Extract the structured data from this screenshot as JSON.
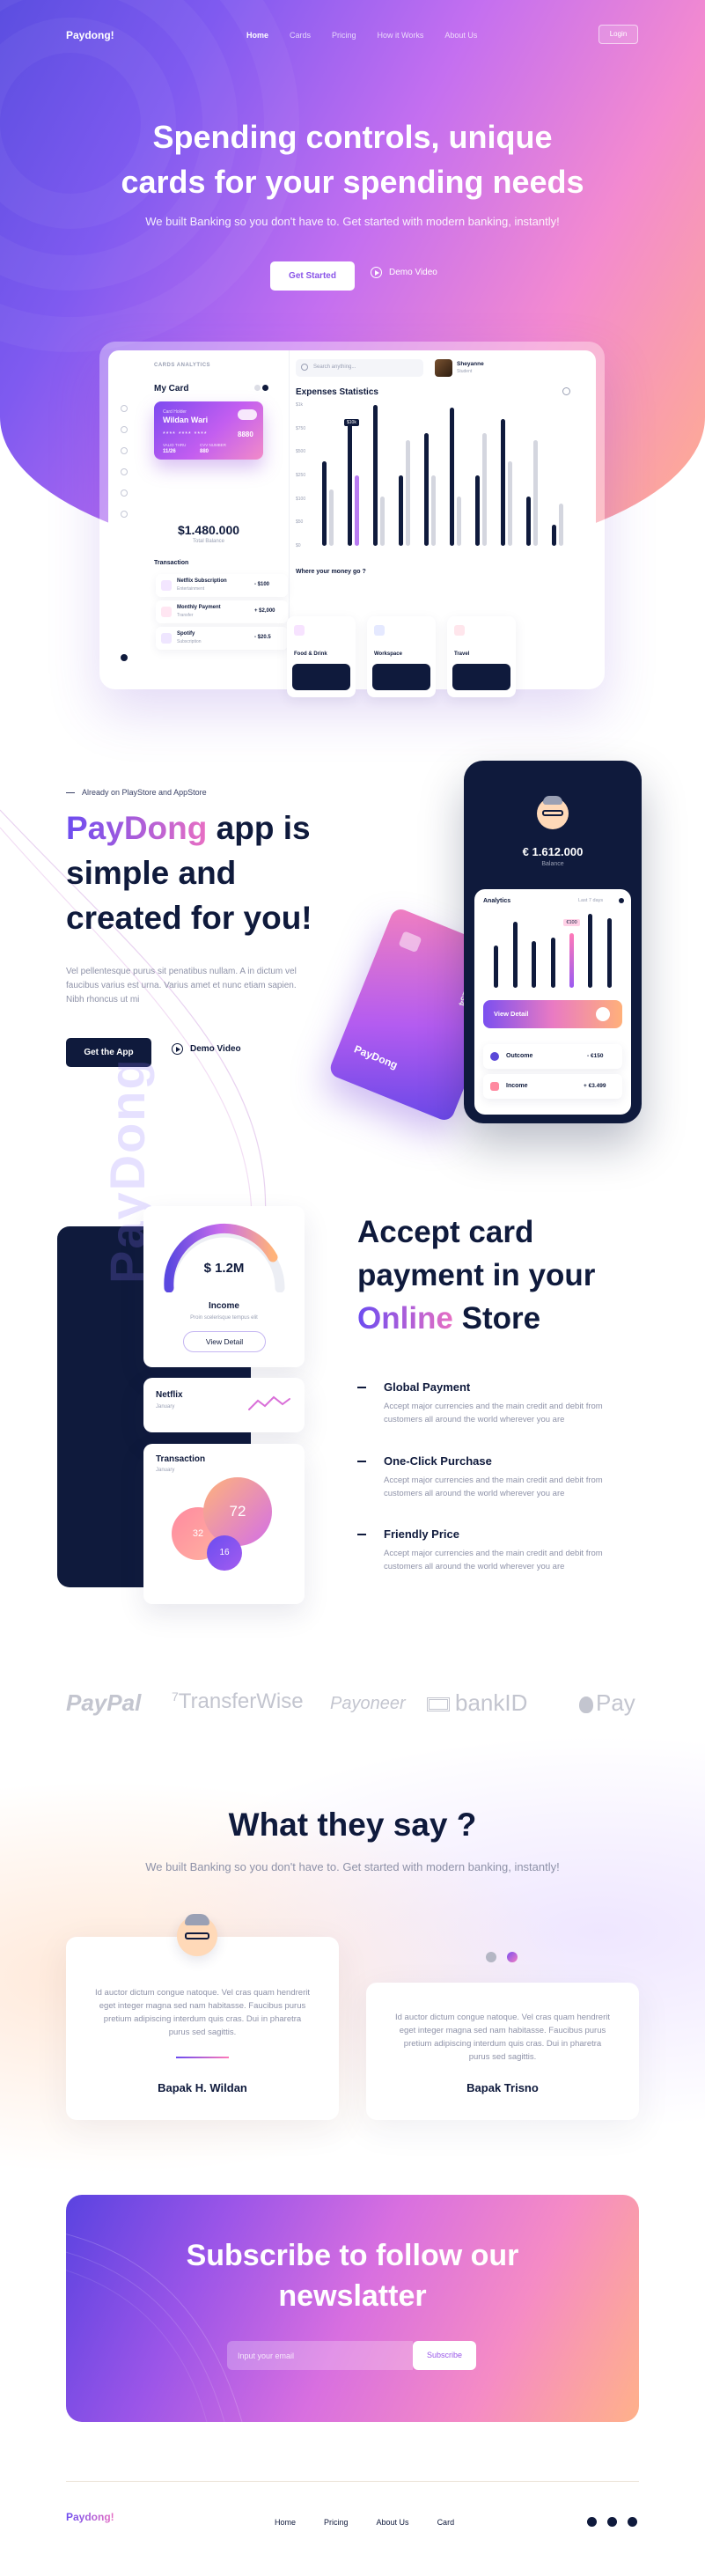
{
  "nav": {
    "logo": "Paydong!",
    "links": [
      "Home",
      "Cards",
      "Pricing",
      "How it Works",
      "About Us"
    ],
    "login": "Login"
  },
  "hero": {
    "title_line1": "Spending controls, unique",
    "title_line2": "cards for your spending needs",
    "subtitle": "We built Banking so you don't have to. Get started with modern banking, instantly!",
    "cta_primary": "Get Started",
    "cta_secondary": "Demo Video"
  },
  "dashboard": {
    "header": "CARDS ANALYTICS",
    "search_placeholder": "Search anything...",
    "user_name": "Sheyanne",
    "user_role": "Student",
    "my_card": "My Card",
    "card_owner_label": "Card Holder",
    "card_owner": "Wildan Wari",
    "card_number_masked": "****  ****  ****",
    "card_number_last": "8880",
    "card_valid_label": "VALID THRU",
    "card_valid": "11/26",
    "card_cvv_label": "CVV NUMBER",
    "card_cvv": "880",
    "balance": "$1.480.000",
    "balance_label": "Total Balance",
    "transaction_title": "Transaction",
    "transactions": [
      {
        "name": "Netflix Subscription",
        "sub": "Entertainment",
        "amount": "- $100"
      },
      {
        "name": "Monthly Payment",
        "sub": "Transfer",
        "amount": "+ $2,000"
      },
      {
        "name": "Spotify",
        "sub": "Subscription",
        "amount": "- $20.5"
      }
    ],
    "expenses_title": "Expenses Statistics",
    "expenses_y": [
      "$1k",
      "$750",
      "$500",
      "$250",
      "$100",
      "$50",
      "$0"
    ],
    "expenses_tag": "$10k",
    "where_title": "Where your money go ?",
    "categories": [
      "Food & Drink",
      "Workspace",
      "Travel"
    ]
  },
  "chart_data": [
    {
      "type": "bar",
      "title": "Expenses Statistics",
      "categories": [
        "1",
        "2",
        "3",
        "4",
        "5",
        "6",
        "7",
        "8",
        "9",
        "10"
      ],
      "series": [
        {
          "values": [
            600,
            900,
            1000,
            500,
            800,
            980,
            500,
            900,
            350,
            150
          ]
        },
        {
          "values": [
            400,
            500,
            350,
            750,
            500,
            350,
            800,
            600,
            750,
            300
          ]
        }
      ],
      "ylim": [
        0,
        1000
      ],
      "colors": {
        "primary": "#0f1a3c",
        "secondary": "#d4d6df",
        "highlight": "#b97cf2"
      }
    },
    {
      "type": "bar",
      "title": "Analytics",
      "categories": [
        "1",
        "2",
        "3",
        "4",
        "5",
        "6",
        "7"
      ],
      "values": [
        55,
        85,
        60,
        65,
        70,
        95,
        90
      ],
      "ylim": [
        0,
        100
      ]
    }
  ],
  "paydong": {
    "eyebrow": "Already on PlayStore and AppStore",
    "title_brand": "PayDong",
    "title_rest1": " app is",
    "title_rest2": "simple and",
    "title_rest3": "created for you!",
    "description": "Vel pellentesque purus sit penatibus nullam. A in dictum vel faucibus varius est urna. Varius amet et nunc etiam sapien. Nibh rhoncus ut mi",
    "cta_primary": "Get the App",
    "cta_secondary": "Demo Video",
    "phone": {
      "balance": "€ 1.612.000",
      "balance_label": "Balance",
      "analytics_label": "Analytics",
      "period": "Last 7 days",
      "tooltip": "€100",
      "view_detail": "View Detail",
      "outcome_label": "Outcome",
      "outcome_value": "- €150",
      "income_label": "Income",
      "income_value": "+ €3.499"
    },
    "card_brand": "PayDong",
    "card_number": "1234"
  },
  "accept": {
    "title_line1": "Accept card",
    "title_line2": "payment in your",
    "title_online": "Online",
    "title_store": " Store",
    "vertical_brand": "PayDong",
    "gauge_value": "$ 1.2M",
    "gauge_label": "Income",
    "gauge_desc": "Proin scelerisque tempus elit",
    "gauge_button": "View Detail",
    "netflix_label": "Netflix",
    "netflix_sub": "January",
    "transaction_label": "Transaction",
    "transaction_sub": "January",
    "bubbles": [
      "72",
      "32",
      "16"
    ],
    "features": [
      {
        "title": "Global Payment",
        "text": "Accept major currencies and the main credit and debit from customers all around the world wherever you are"
      },
      {
        "title": "One-Click Purchase",
        "text": "Accept major currencies and the main credit and debit from customers all around the world wherever you are"
      },
      {
        "title": "Friendly Price",
        "text": "Accept major currencies and the main credit and debit from customers all around the world wherever you are"
      }
    ]
  },
  "logos": [
    "PayPal",
    "TransferWise",
    "Payoneer",
    "bankID",
    "Pay"
  ],
  "testimonials": {
    "title": "What they say ?",
    "subtitle": "We built Banking so you don't have to. Get started with modern banking, instantly!",
    "items": [
      {
        "quote": "Id auctor dictum congue natoque. Vel cras quam hendrerit eget integer magna sed nam habitasse. Faucibus purus pretium adipiscing interdum quis cras. Dui in pharetra purus sed sagittis.",
        "name": "Bapak H. Wildan"
      },
      {
        "quote": "Id auctor dictum congue natoque. Vel cras quam hendrerit eget integer magna sed nam habitasse. Faucibus purus pretium adipiscing interdum quis cras. Dui in pharetra purus sed sagittis.",
        "name": "Bapak Trisno"
      }
    ]
  },
  "subscribe": {
    "title_line1": "Subscribe to follow our",
    "title_line2": "newslatter",
    "placeholder": "Input your email",
    "button": "Subscribe"
  },
  "footer": {
    "logo": "Paydong!",
    "links": [
      "Home",
      "Pricing",
      "About Us",
      "Card"
    ]
  },
  "colors": {
    "navy": "#0f1a3c",
    "purple": "#7d4af0",
    "pink": "#f28bc8",
    "peach": "#ffb08a",
    "muted_text": "#8e92a8"
  }
}
